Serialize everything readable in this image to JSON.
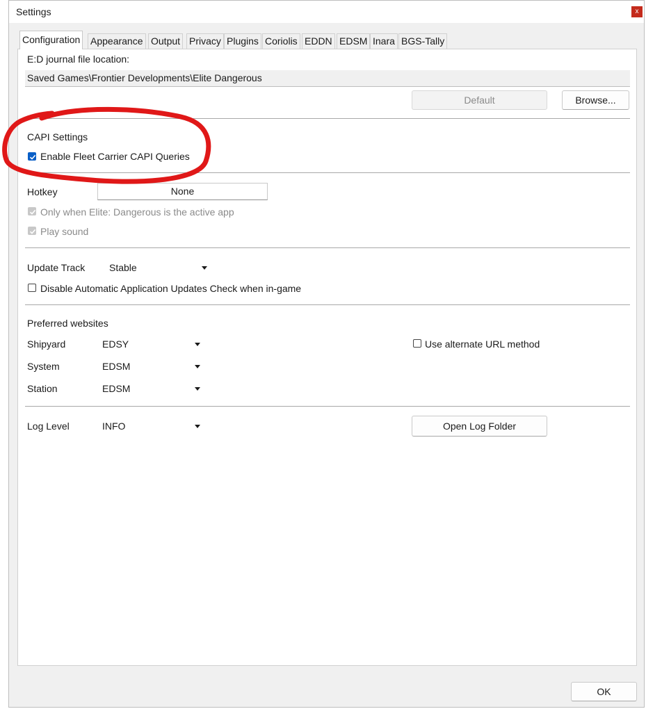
{
  "window": {
    "title": "Settings",
    "close_label": "x"
  },
  "tabs": [
    "Configuration",
    "Appearance",
    "Output",
    "Privacy",
    "Plugins",
    "Coriolis",
    "EDDN",
    "EDSM",
    "Inara",
    "BGS-Tally"
  ],
  "journal": {
    "label": "E:D journal file location:",
    "path": "Saved Games\\Frontier Developments\\Elite Dangerous",
    "default_button": "Default",
    "browse_button": "Browse..."
  },
  "capi": {
    "heading": "CAPI Settings",
    "fleet_carrier_label": "Enable Fleet Carrier CAPI Queries",
    "fleet_carrier_checked": true
  },
  "hotkey": {
    "label": "Hotkey",
    "value": "None",
    "only_active_label": "Only when Elite: Dangerous is the active app",
    "play_sound_label": "Play sound"
  },
  "update": {
    "label": "Update Track",
    "track": "Stable",
    "disable_auto_label": "Disable Automatic Application Updates Check when in-game"
  },
  "websites": {
    "heading": "Preferred websites",
    "shipyard_label": "Shipyard",
    "shipyard_value": "EDSY",
    "system_label": "System",
    "system_value": "EDSM",
    "station_label": "Station",
    "station_value": "EDSM",
    "alt_url_label": "Use alternate URL method"
  },
  "log": {
    "label": "Log Level",
    "value": "INFO",
    "open_folder_button": "Open Log Folder"
  },
  "ok_button": "OK",
  "colors": {
    "accent": "#0a5fc7",
    "annotation": "#e01818",
    "close": "#c42b1c"
  }
}
